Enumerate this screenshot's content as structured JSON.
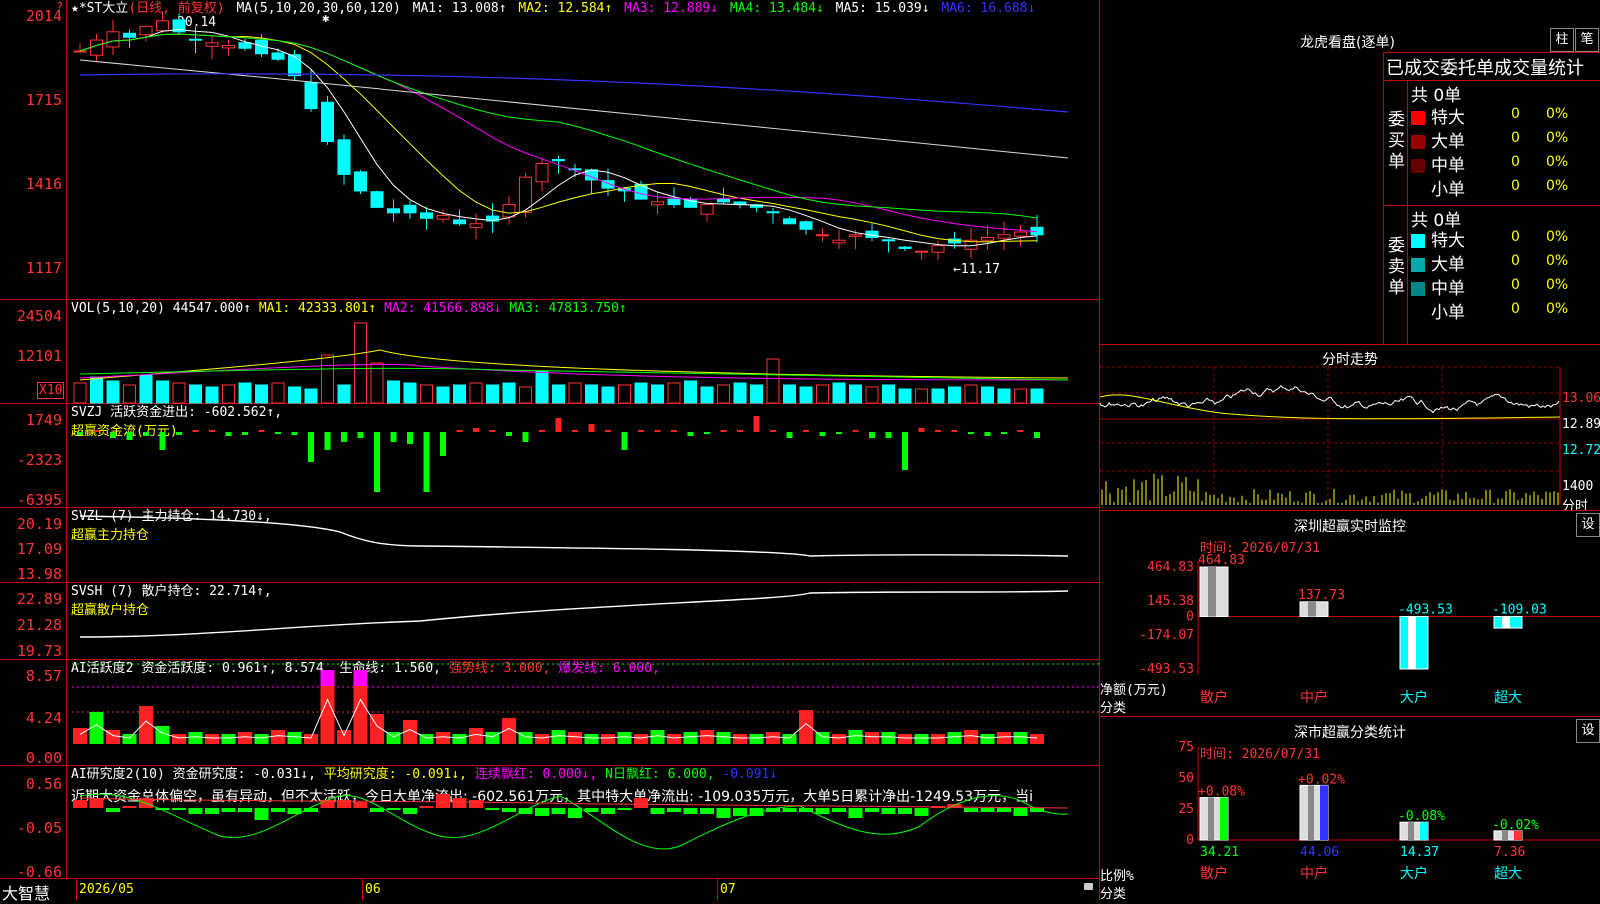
{
  "main": {
    "axis": [
      "2014",
      "1715",
      "1416",
      "1117"
    ],
    "header": {
      "name": "★*ST大立",
      "period": "(日线, 前复权)",
      "ma_params": "MA(5,10,20,30,60,120)",
      "ma1": "MA1: 13.008↑",
      "ma2": "MA2: 12.584↑",
      "ma3": "MA3: 12.889↓",
      "ma4": "MA4: 13.484↓",
      "ma5": "MA5: 15.039↓",
      "ma6": "MA6: 16.688↓"
    },
    "high_label": "20.14",
    "low_label": "←11.17"
  },
  "vol": {
    "axis": [
      "24504",
      "12101"
    ],
    "unit": "X10",
    "header": {
      "name": "VOL(5,10,20)",
      "value": "44547.000↑",
      "ma1": "MA1: 42333.801↑",
      "ma2": "MA2: 41566.898↓",
      "ma3": "MA3: 47813.750↑"
    }
  },
  "svzj": {
    "axis": [
      "1749",
      "-2323",
      "-6395"
    ],
    "header": {
      "name": "SVZJ",
      "label": "活跃资金进出: -602.562↑,"
    },
    "sub": "超赢资金流(万元)"
  },
  "svzl": {
    "axis": [
      "20.19",
      "17.09",
      "13.98"
    ],
    "header": {
      "name": "SVZL (7)",
      "label": "主力持仓: 14.730↓,"
    },
    "sub": "超赢主力持仓"
  },
  "svsh": {
    "axis": [
      "22.89",
      "21.28",
      "19.73"
    ],
    "header": {
      "name": "SVSH (7)",
      "label": "散户持仓: 22.714↑,"
    },
    "sub": "超赢散户持仓"
  },
  "ai2": {
    "axis": [
      "8.57",
      "4.24",
      "0.00"
    ],
    "header": {
      "name": "AI活跃度2",
      "label": "资金活跃度: 0.961↑, 8.574,",
      "life": "生命线: 1.560,",
      "strong": "强势线: 3.000,",
      "burst": "爆发线: 6.000,"
    }
  },
  "ai_research": {
    "axis": [
      "0.56",
      "-0.05",
      "-0.66"
    ],
    "header": {
      "name": "AI研究度2(10)",
      "label": "资金研究度: -0.031↓,",
      "avg": "平均研究度: -0.091↓,",
      "lianxu": "连续飘红: 0.000↓,",
      "nri": "N日飘红: 6.000,",
      "extra": "-0.091↓"
    },
    "text": "近期大资金总体偏空，虽有异动，但不太活跃，今日大单净流出: -602.561万元，其中特大单净流出: -109.035万元，大单5日累计净出-1249.53万元，当i"
  },
  "bottom": {
    "brand": "大智慧",
    "dates": [
      "2026/05",
      "06",
      "07"
    ]
  },
  "lhb": {
    "title": "龙虎看盘(逐单)",
    "btn1": "柱",
    "btn2": "笔",
    "heading": "已成交委托单成交量统计",
    "buy": {
      "side": "委买单",
      "total": "共 0单",
      "rows": [
        {
          "label": "特大",
          "n": "0",
          "pct": "0%",
          "color": "#ff0000"
        },
        {
          "label": "大单",
          "n": "0",
          "pct": "0%",
          "color": "#990000"
        },
        {
          "label": "中单",
          "n": "0",
          "pct": "0%",
          "color": "#660000"
        },
        {
          "label": "小单",
          "n": "0",
          "pct": "0%",
          "color": ""
        }
      ]
    },
    "sell": {
      "side": "委卖单",
      "total": "共 0单",
      "rows": [
        {
          "label": "特大",
          "n": "0",
          "pct": "0%",
          "color": "#00ffff"
        },
        {
          "label": "大单",
          "n": "0",
          "pct": "0%",
          "color": "#00aaaa"
        },
        {
          "label": "中单",
          "n": "0",
          "pct": "0%",
          "color": "#008888"
        },
        {
          "label": "小单",
          "n": "0",
          "pct": "0%",
          "color": ""
        }
      ]
    }
  },
  "fenshi": {
    "title": "分时走势",
    "price_axis": [
      "13.06",
      "12.89",
      "12.72"
    ],
    "vol_axis": "1400",
    "vol_unit": "分时"
  },
  "monitor": {
    "title": "深圳超赢实时监控",
    "settings": "设",
    "time": "时间: 2026/07/31",
    "axis": [
      "464.83",
      "145.38",
      "0",
      "-174.07",
      "-493.53"
    ],
    "ylabel": "净额(万元)",
    "xlabel": "分类",
    "bars": [
      {
        "cat": "散户",
        "value": 464.83,
        "label": "464.83"
      },
      {
        "cat": "中户",
        "value": 137.73,
        "label": "137.73"
      },
      {
        "cat": "大户",
        "value": -493.53,
        "label": "-493.53"
      },
      {
        "cat": "超大",
        "value": -109.03,
        "label": "-109.03"
      }
    ]
  },
  "classify": {
    "title": "深市超赢分类统计",
    "settings": "设",
    "time": "时间: 2026/07/31",
    "axis": [
      "75",
      "50",
      "25",
      "0"
    ],
    "ylabel": "比例%",
    "xlabel": "分类",
    "bars": [
      {
        "cat": "散户",
        "value": 34.21,
        "label": "34.21",
        "change": "+0.08%"
      },
      {
        "cat": "中户",
        "value": 44.06,
        "label": "44.06",
        "change": "+0.02%"
      },
      {
        "cat": "大户",
        "value": 14.37,
        "label": "14.37",
        "change": "-0.08%"
      },
      {
        "cat": "超大",
        "value": 7.36,
        "label": "7.36",
        "change": "-0.02%"
      }
    ]
  }
}
